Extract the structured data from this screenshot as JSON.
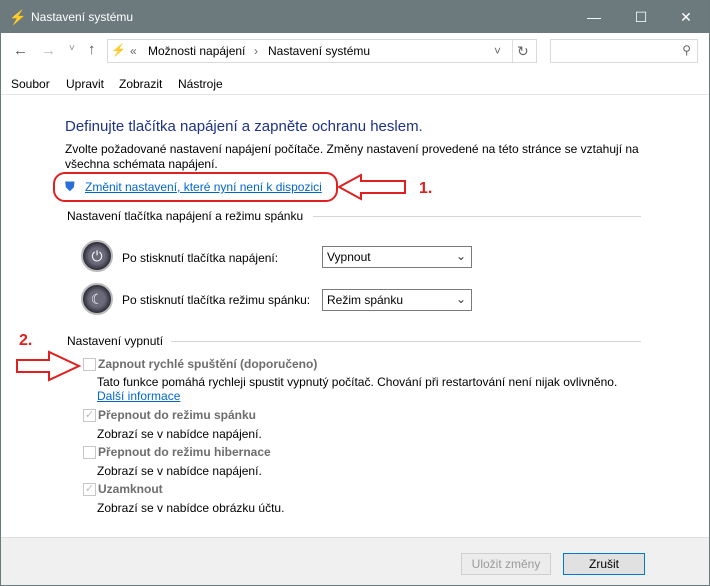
{
  "window": {
    "title": "Nastavení systému",
    "minimize": "—",
    "maximize": "☐",
    "close": "✕"
  },
  "nav": {
    "back": "←",
    "forward": "→",
    "recent": "˅",
    "up": "↑",
    "breadcrumb_overflow": "«",
    "breadcrumb": [
      "Možnosti napájení",
      "Nastavení systému"
    ],
    "separator": "›",
    "dropdown": "˅",
    "refresh": "↻",
    "search_placeholder": "",
    "search_icon": "⚲"
  },
  "menu": [
    "Soubor",
    "Upravit",
    "Zobrazit",
    "Nástroje"
  ],
  "main": {
    "heading": "Definujte tlačítka napájení a zapněte ochranu heslem.",
    "description": "Zvolte požadované nastavení napájení počítače. Změny nastavení provedené na této stránce se vztahují na všechna schémata napájení.",
    "change_link": "Změnit nastavení, které nyní není k dispozici",
    "section1": "Nastavení tlačítka napájení a režimu spánku",
    "power_label": "Po stisknutí tlačítka napájení:",
    "power_value": "Vypnout",
    "sleep_label": "Po stisknutí tlačítka režimu spánku:",
    "sleep_value": "Režim spánku",
    "section2": "Nastavení vypnutí",
    "options": [
      {
        "label": "Zapnout rychlé spuštění (doporučeno)",
        "desc": "Tato funkce pomáhá rychleji spustit vypnutý počítač. Chování při restartování není nijak ovlivněno.",
        "link": "Další informace",
        "checked": false
      },
      {
        "label": "Přepnout do režimu spánku",
        "desc": "Zobrazí se v nabídce napájení.",
        "checked": true
      },
      {
        "label": "Přepnout do režimu hibernace",
        "desc": "Zobrazí se v nabídce napájení.",
        "checked": false
      },
      {
        "label": "Uzamknout",
        "desc": "Zobrazí se v nabídce obrázku účtu.",
        "checked": true
      }
    ]
  },
  "annotations": {
    "a1": "1.",
    "a2": "2."
  },
  "footer": {
    "save": "Uložit změny",
    "cancel": "Zrušit"
  },
  "colors": {
    "titlebar": "#6c7a7e",
    "heading": "#1e3287",
    "annotation": "#e02020"
  }
}
